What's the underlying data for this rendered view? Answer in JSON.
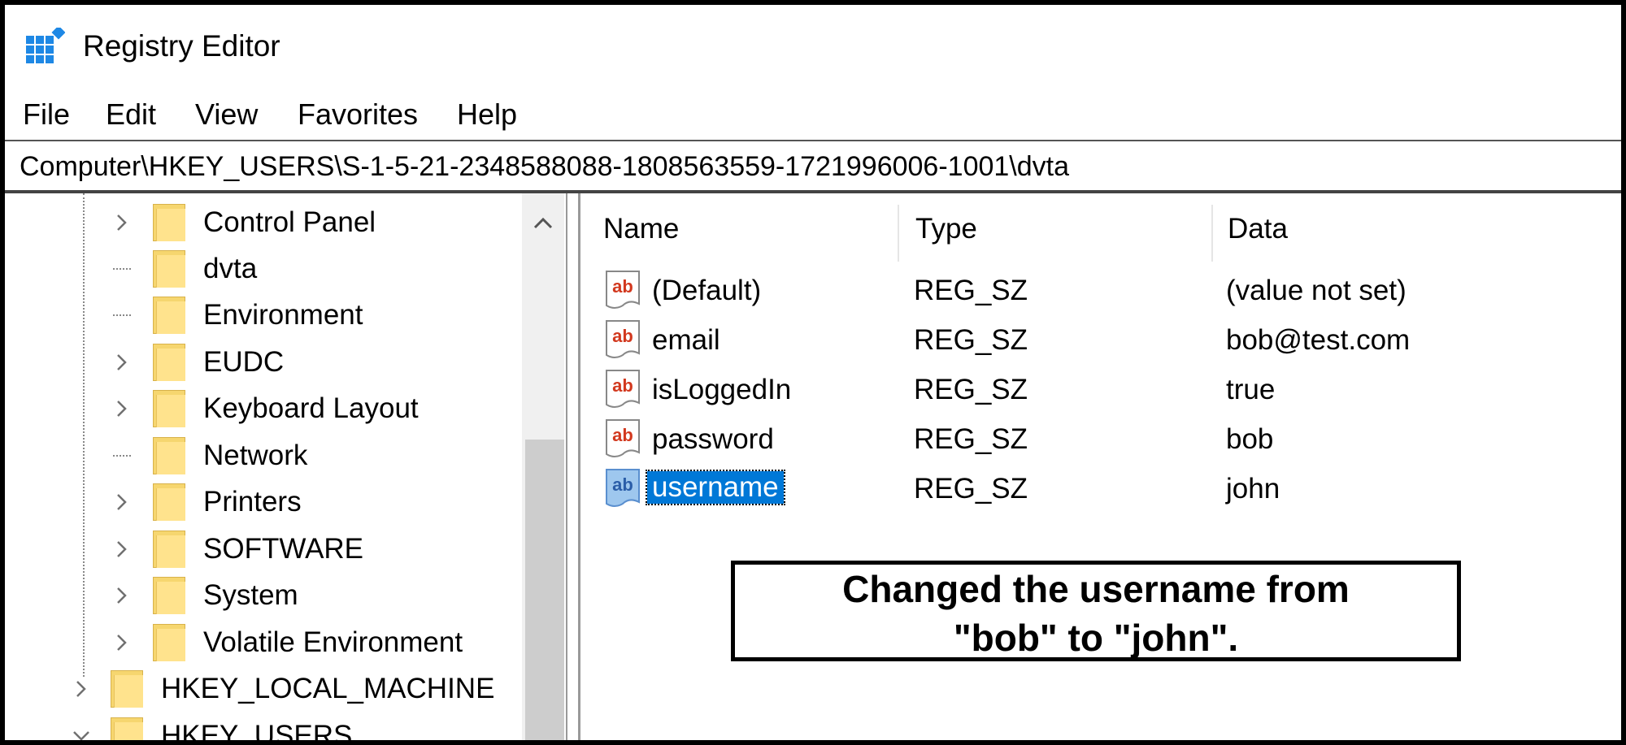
{
  "window": {
    "title": "Registry Editor",
    "icon": "registry-editor-icon"
  },
  "menu": [
    "File",
    "Edit",
    "View",
    "Favorites",
    "Help"
  ],
  "address": "Computer\\HKEY_USERS\\S-1-5-21-2348588088-1808563559-1721996006-1001\\dvta",
  "tree": {
    "children": [
      {
        "label": "Control Panel",
        "expander": "collapsed"
      },
      {
        "label": "dvta",
        "expander": "none"
      },
      {
        "label": "Environment",
        "expander": "none"
      },
      {
        "label": "EUDC",
        "expander": "collapsed"
      },
      {
        "label": "Keyboard Layout",
        "expander": "collapsed"
      },
      {
        "label": "Network",
        "expander": "none"
      },
      {
        "label": "Printers",
        "expander": "collapsed"
      },
      {
        "label": "SOFTWARE",
        "expander": "collapsed"
      },
      {
        "label": "System",
        "expander": "collapsed"
      },
      {
        "label": "Volatile Environment",
        "expander": "collapsed"
      }
    ],
    "roots": [
      {
        "label": "HKEY_LOCAL_MACHINE",
        "expander": "collapsed"
      },
      {
        "label": "HKEY_USERS",
        "expander": "expanded"
      }
    ]
  },
  "columns": {
    "name": "Name",
    "type": "Type",
    "data": "Data"
  },
  "values": [
    {
      "name": "(Default)",
      "type": "REG_SZ",
      "data": "(value not set)",
      "selected": false
    },
    {
      "name": "email",
      "type": "REG_SZ",
      "data": "bob@test.com",
      "selected": false
    },
    {
      "name": "isLoggedIn",
      "type": "REG_SZ",
      "data": "true",
      "selected": false
    },
    {
      "name": "password",
      "type": "REG_SZ",
      "data": "bob",
      "selected": false
    },
    {
      "name": "username",
      "type": "REG_SZ",
      "data": "john",
      "selected": true
    }
  ],
  "annotation": {
    "line1": "Changed the username from",
    "line2": "\"bob\" to \"john\"."
  },
  "colors": {
    "selection": "#0078d7",
    "folder": "#ffe38d",
    "reg_icon_text": "#d2381e",
    "app_icon": "#1e88e5"
  }
}
